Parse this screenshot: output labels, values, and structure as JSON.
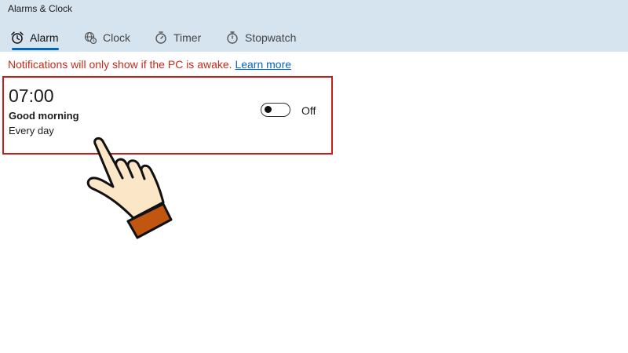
{
  "window": {
    "title": "Alarms & Clock"
  },
  "tabs": [
    {
      "label": "Alarm",
      "icon": "alarm-clock-icon",
      "active": true
    },
    {
      "label": "Clock",
      "icon": "globe-clock-icon",
      "active": false
    },
    {
      "label": "Timer",
      "icon": "timer-icon",
      "active": false
    },
    {
      "label": "Stopwatch",
      "icon": "stopwatch-icon",
      "active": false
    }
  ],
  "notice": {
    "text": "Notifications will only show if the PC is awake.",
    "link": "Learn more",
    "color": "#c42b1c",
    "link_color": "#0067c0"
  },
  "alarm": {
    "time": "07:00",
    "name": "Good morning",
    "repeat": "Every day",
    "toggle_state": "Off",
    "enabled": false
  },
  "highlight": {
    "color": "#cc1b1b",
    "pointer_icon": "hand-pointer-icon"
  },
  "colors": {
    "header_bg": "#d6e4ef",
    "accent": "#0067c0"
  }
}
